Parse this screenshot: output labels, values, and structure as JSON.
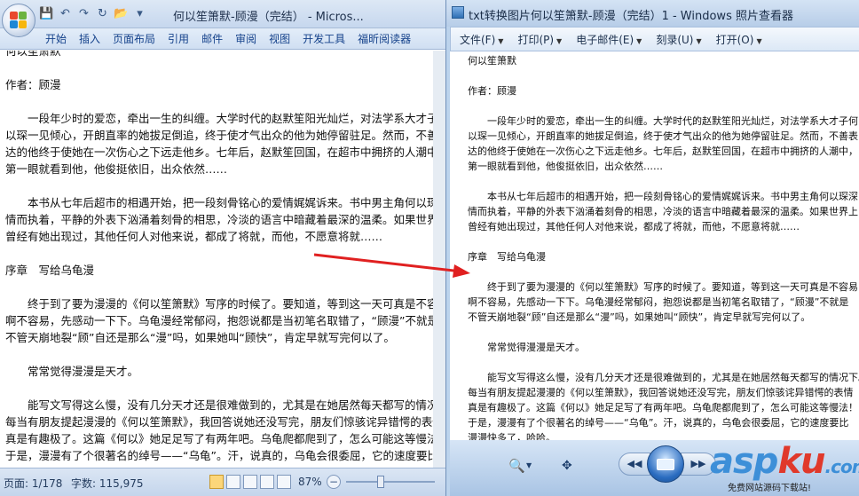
{
  "word": {
    "title": "何以笙箫默-顾漫（完结） - Micros...",
    "quick_access_icons": [
      "save-icon",
      "undo-icon",
      "redo-icon",
      "repeat-icon",
      "open-folder-icon",
      "customize-icon"
    ],
    "ribbon_tabs": [
      "开始",
      "插入",
      "页面布局",
      "引用",
      "邮件",
      "审阅",
      "视图",
      "开发工具",
      "福昕阅读器"
    ],
    "lines": [
      "何以笙箫默",
      "",
      "作者：顾漫",
      "",
      "　　一段年少时的爱恋，牵出一生的纠缠。大学时代的赵默笙阳光灿烂，对法学系大才子何",
      "以琛一见倾心，开朗直率的她拔足倒追，终于使才气出众的他为她停留驻足。然而，不善表",
      "达的他终于使她在一次伤心之下远走他乡。七年后，赵默笙回国，在超市中拥挤的人潮中，",
      "第一眼就看到他，他俊挺依旧，出众依然……",
      "",
      "　　本书从七年后超市的相遇开始，把一段刻骨铭心的爱情娓娓诉来。书中男主角何以琛深",
      "情而执着，平静的外表下汹涌着刻骨的相思，冷淡的语言中暗藏着最深的温柔。如果世界上",
      "曾经有她出现过，其他任何人对他来说，都成了将就，而他，不愿意将就……",
      "",
      "序章　写给乌龟漫",
      "",
      "　　终于到了要为漫漫的《何以笙箫默》写序的时候了。要知道，等到这一天可真是不容易",
      "啊不容易，先感动一下下。乌龟漫经常郁闷，抱怨说都是当初笔名取错了，“顾漫”不就是",
      "不管天崩地裂“顾”自还是那么“漫”吗，如果她叫“顾快”，肯定早就写完何以了。",
      "",
      "　　常常觉得漫漫是天才。",
      "",
      "　　能写文写得这么慢，没有几分天才还是很难做到的，尤其是在她居然每天都写的情况下。",
      "每当有朋友提起漫漫的《何以笙箫默》，我回答说她还没写完，朋友们惊骇诧异错愕的表情",
      "真是有趣极了。这篇《何以》她足足写了有两年吧。乌龟爬都爬到了，怎么可能这等慢法！",
      "于是，漫漫有了个很著名的绰号——“乌龟”。汗，说真的，乌龟会很委屈，它的速度要比"
    ],
    "status": {
      "page": "页面: 1/178",
      "words": "字数: 115,975",
      "zoom": "87%",
      "zoom_level_percent": 87
    }
  },
  "viewer": {
    "title": "txt转换图片何以笙箫默-顾漫（完结）1 - Windows 照片查看器",
    "menu": [
      "文件(F)",
      "打印(P)",
      "电子邮件(E)",
      "刻录(U)",
      "打开(O)"
    ],
    "menu_caret": "▼",
    "lines": [
      "何以笙箫默",
      "",
      "作者：顾漫",
      "",
      "　　一段年少时的爱恋，牵出一生的纠缠。大学时代的赵默笙阳光灿烂，对法学系大才子何",
      "以琛一见倾心，开朗直率的她拔足倒追，终于使才气出众的他为她停留驻足。然而，不善表",
      "达的他终于使她在一次伤心之下远走他乡。七年后，赵默笙回国，在超市中拥挤的人潮中，",
      "第一眼就看到他，他俊挺依旧，出众依然……",
      "",
      "　　本书从七年后超市的相遇开始，把一段刻骨铭心的爱情娓娓诉来。书中男主角何以琛深",
      "情而执着，平静的外表下汹涌着刻骨的相思，冷淡的语言中暗藏着最深的温柔。如果世界上",
      "曾经有她出现过，其他任何人对他来说，都成了将就，而他，不愿意将就……",
      "",
      "序章　写给乌龟漫",
      "",
      "　　终于到了要为漫漫的《何以笙箫默》写序的时候了。要知道，等到这一天可真是不容易",
      "啊不容易，先感动一下下。乌龟漫经常郁闷，抱怨说都是当初笔名取错了，“顾漫”不就是",
      "不管天崩地裂“顾”自还是那么“漫”吗，如果她叫“顾快”，肯定早就写完何以了。",
      "",
      "　　常常觉得漫漫是天才。",
      "",
      "　　能写文写得这么慢，没有几分天才还是很难做到的，尤其是在她居然每天都写的情况下。",
      "每当有朋友提起漫漫的《何以笙箫默》，我回答说她还没写完，朋友们惊骇诧异错愕的表情",
      "真是有趣极了。这篇《何以》她足足写了有两年吧。乌龟爬都爬到了，怎么可能这等慢法！",
      "于是，漫漫有了个很著名的绰号——“乌龟”。汗，说真的，乌龟会很委屈，它的速度要比",
      "漫漫快多了，哈哈。"
    ],
    "toolbar_icons": [
      "zoom-icon",
      "fit-to-window-icon",
      "previous-icon",
      "slideshow-icon",
      "next-icon"
    ]
  },
  "watermark": {
    "brand_part1": "asp",
    "brand_part2": "ku",
    "brand_part3": ".com",
    "slogan": "免费网站源码下载站!"
  },
  "colors": {
    "arrow": "#e02020",
    "office_blue": "#15428b"
  }
}
